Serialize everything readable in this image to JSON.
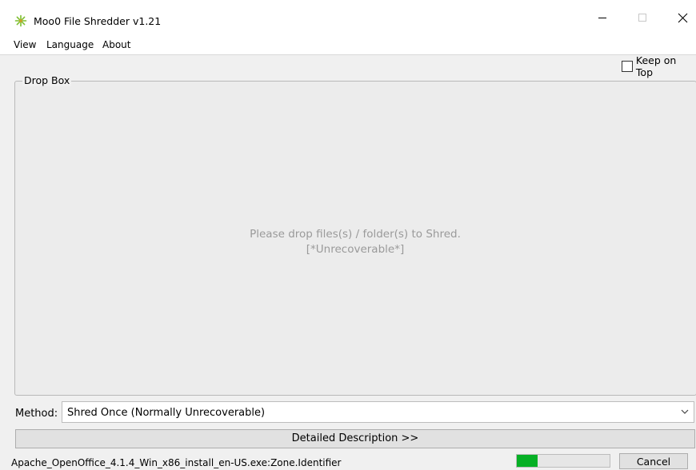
{
  "window": {
    "title": "Moo0 File Shredder v1.21",
    "icon": "moo0-shredder-icon",
    "controls": {
      "minimize": "minimize-icon",
      "maximize": "maximize-icon",
      "close": "close-icon"
    }
  },
  "menu": {
    "view": "View",
    "language": "Language",
    "about": "About"
  },
  "keep_on_top": {
    "label": "Keep on Top",
    "checked": false
  },
  "dropbox": {
    "title": "Drop Box",
    "message_line1": "Please drop files(s) / folder(s) to Shred.",
    "message_line2": "[*Unrecoverable*]"
  },
  "method": {
    "label": "Method:",
    "value": "Shred Once (Normally Unrecoverable)"
  },
  "detail_button": "Detailed Description >>",
  "status": {
    "file": "Apache_OpenOffice_4.1.4_Win_x86_install_en-US.exe:Zone.Identifier",
    "progress": 0.22,
    "progress_color": "#06b025"
  },
  "cancel_button": "Cancel"
}
